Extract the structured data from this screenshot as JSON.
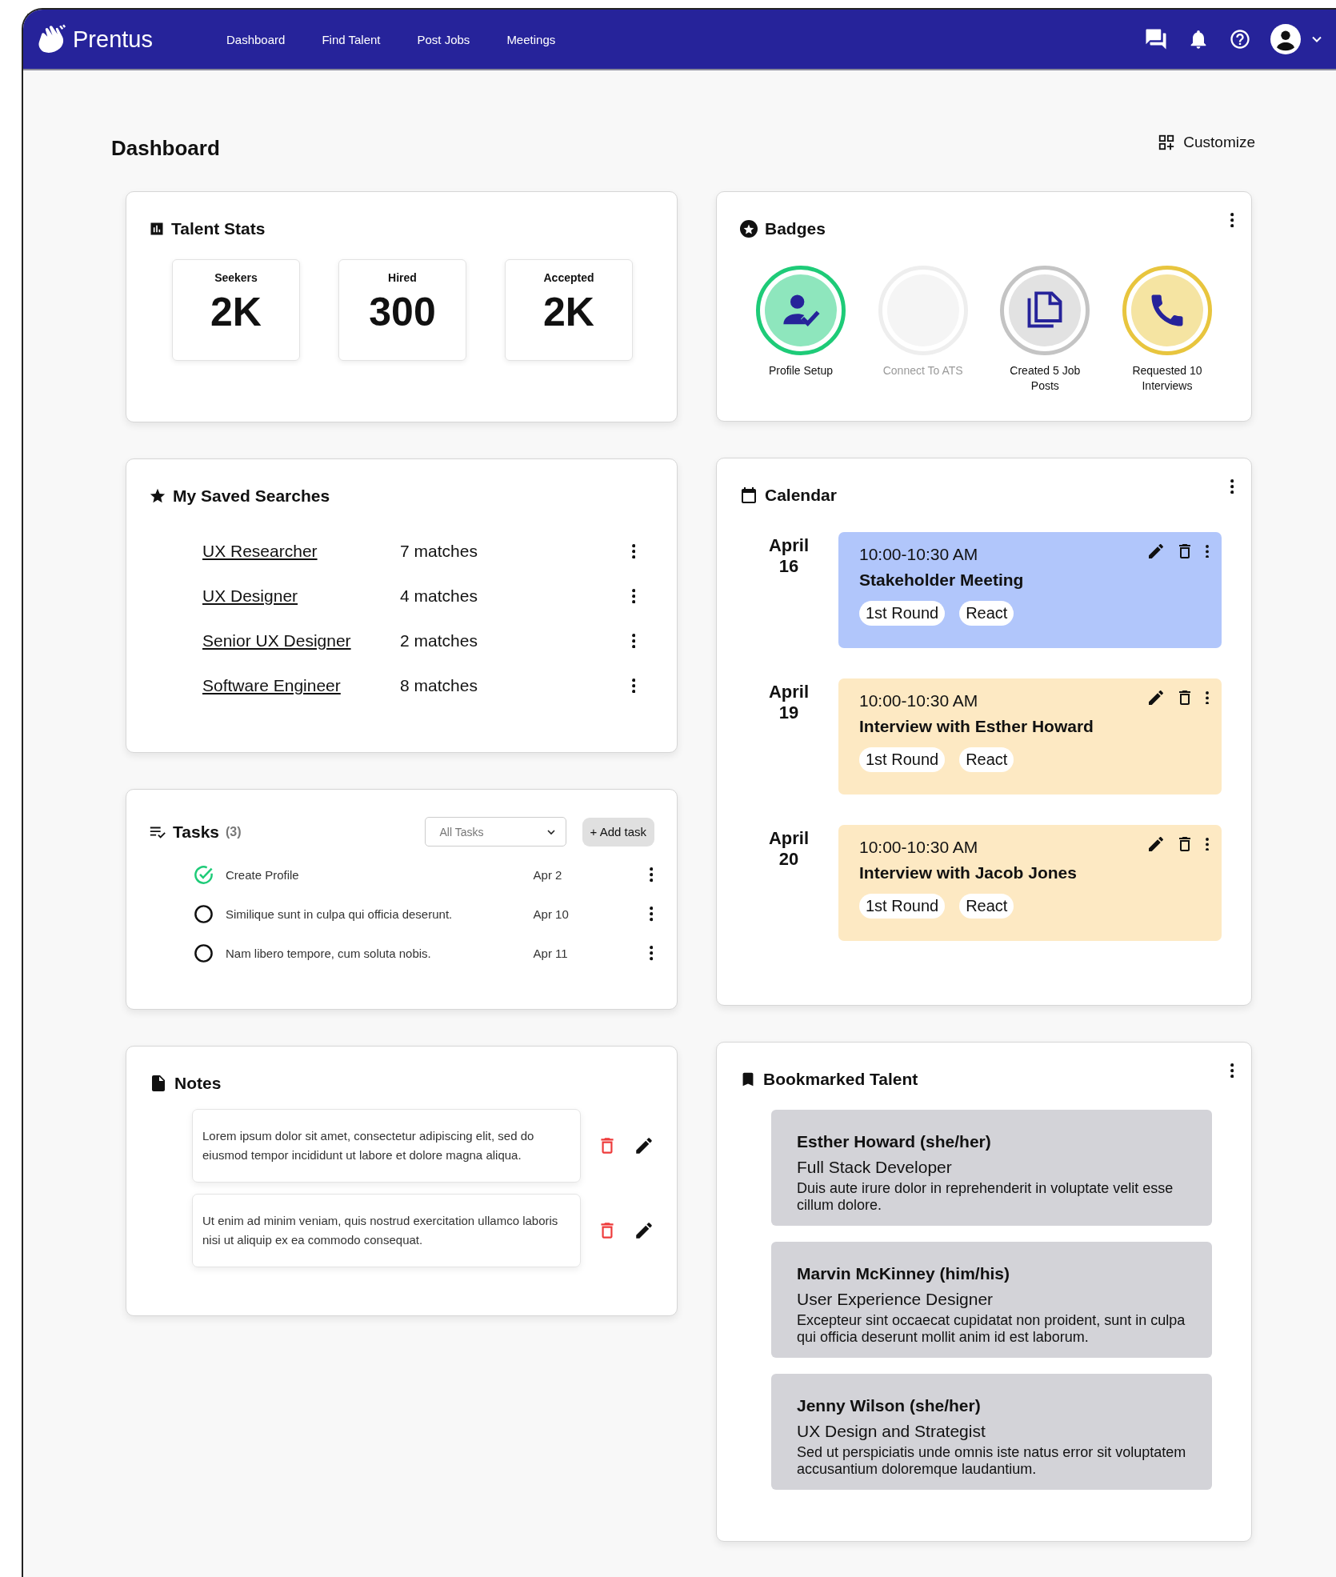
{
  "nav": {
    "brand": "Prentus",
    "links": [
      {
        "label": "Dashboard"
      },
      {
        "label": "Find Talent"
      },
      {
        "label": "Post Jobs"
      },
      {
        "label": "Meetings"
      }
    ]
  },
  "page": {
    "title": "Dashboard",
    "customize": "Customize"
  },
  "talent_stats": {
    "title": "Talent Stats",
    "stats": [
      {
        "label": "Seekers",
        "value": "2K"
      },
      {
        "label": "Hired",
        "value": "300"
      },
      {
        "label": "Accepted",
        "value": "2K"
      }
    ]
  },
  "badges": {
    "title": "Badges",
    "items": [
      {
        "label": "Profile Setup",
        "kind": "profile",
        "disabled": false,
        "color": "#1ecb78"
      },
      {
        "label": "Connect To ATS",
        "kind": "blank",
        "disabled": true,
        "color": "#eeeeee"
      },
      {
        "label": "Created 5 Job Posts",
        "kind": "documents",
        "disabled": false,
        "color": "#c4c4c4"
      },
      {
        "label": "Requested 10 Interviews",
        "kind": "phone",
        "disabled": false,
        "color": "#e8c53e"
      }
    ]
  },
  "saved_searches": {
    "title": "My Saved Searches",
    "items": [
      {
        "name": "UX Researcher",
        "matches": "7 matches"
      },
      {
        "name": "UX Designer",
        "matches": "4 matches"
      },
      {
        "name": "Senior UX Designer",
        "matches": "2 matches"
      },
      {
        "name": "Software Engineer",
        "matches": "8 matches"
      }
    ]
  },
  "tasks": {
    "title": "Tasks",
    "count": "(3)",
    "filter": {
      "value": "All Tasks"
    },
    "add_button": "+ Add task",
    "items": [
      {
        "text": "Create Profile",
        "date": "Apr 2",
        "checked": true
      },
      {
        "text": "Similique sunt in culpa qui officia deserunt.",
        "date": "Apr 10",
        "checked": false
      },
      {
        "text": "Nam libero tempore, cum soluta nobis.",
        "date": "Apr 11",
        "checked": false
      }
    ]
  },
  "notes": {
    "title": "Notes",
    "items": [
      {
        "text": "Lorem ipsum dolor sit amet, consectetur adipiscing elit, sed do eiusmod tempor incididunt ut labore et dolore magna aliqua."
      },
      {
        "text": "Ut enim ad minim veniam, quis nostrud exercitation ullamco laboris nisi ut aliquip ex ea commodo consequat."
      }
    ]
  },
  "calendar": {
    "title": "Calendar",
    "events": [
      {
        "month": "April",
        "day": "16",
        "time": "10:00-10:30 AM",
        "title": "Stakeholder Meeting",
        "color": "#b1c6fb",
        "tags": [
          "1st Round",
          "React"
        ]
      },
      {
        "month": "April",
        "day": "19",
        "time": "10:00-10:30 AM",
        "title": "Interview with Esther Howard",
        "color": "#fde9c3",
        "tags": [
          "1st Round",
          "React"
        ]
      },
      {
        "month": "April",
        "day": "20",
        "time": "10:00-10:30 AM",
        "title": "Interview with Jacob Jones",
        "color": "#fde9c3",
        "tags": [
          "1st Round",
          "React"
        ]
      }
    ]
  },
  "bookmarked_talent": {
    "title": "Bookmarked Talent",
    "items": [
      {
        "name": "Esther Howard (she/her)",
        "role": "Full Stack Developer",
        "summary": "Duis aute irure dolor in reprehenderit in voluptate velit esse cillum dolore."
      },
      {
        "name": "Marvin McKinney (him/his)",
        "role": "User Experience Designer",
        "summary": "Excepteur sint occaecat cupidatat non proident, sunt in culpa qui officia deserunt mollit anim id est laborum."
      },
      {
        "name": "Jenny Wilson (she/her)",
        "role": "UX Design and Strategist",
        "summary": "Sed ut perspiciatis unde omnis iste natus error sit voluptatem accusantium doloremque laudantium."
      }
    ]
  }
}
